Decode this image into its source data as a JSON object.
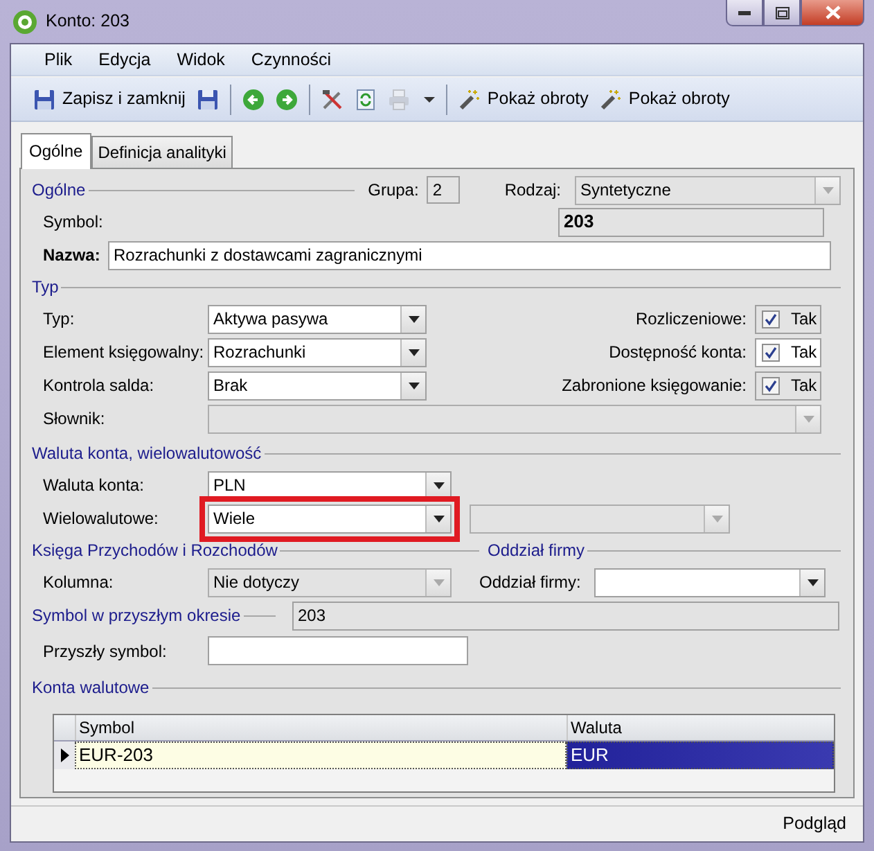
{
  "window": {
    "title": "Konto: 203"
  },
  "menu": [
    {
      "label": "Plik"
    },
    {
      "label": "Edycja"
    },
    {
      "label": "Widok"
    },
    {
      "label": "Czynności"
    }
  ],
  "toolbar": [
    {
      "kind": "button",
      "label": "Zapisz i zamknij",
      "disabled": false
    },
    {
      "kind": "icon",
      "disabled": false
    },
    {
      "kind": "separator"
    },
    {
      "kind": "icon",
      "disabled": false
    },
    {
      "kind": "icon",
      "disabled": false
    },
    {
      "kind": "separator"
    },
    {
      "kind": "icon",
      "disabled": false
    },
    {
      "kind": "icon",
      "disabled": false
    },
    {
      "kind": "dropdown",
      "disabled": true
    },
    {
      "kind": "separator"
    },
    {
      "kind": "button",
      "label": "Pokaż obroty",
      "disabled": false
    },
    {
      "kind": "button",
      "label": "Pokaż obroty",
      "disabled": false
    }
  ],
  "tabs": [
    {
      "label": "Ogólne",
      "selected": true
    },
    {
      "label": "Definicja analityki",
      "selected": false
    }
  ],
  "general": {
    "heading": "Ogólne",
    "group_label": "Grupa:",
    "group": "2",
    "kind_label": "Rodzaj:",
    "kind_value": "Syntetyczne",
    "symbol_label": "Symbol:",
    "symbol": "203",
    "name_label": "Nazwa:",
    "name": "Rozrachunki z dostawcami zagranicznymi"
  },
  "typ": {
    "heading": "Typ",
    "fields": [
      {
        "label": "Typ:",
        "value": "Aktywa pasywa",
        "disabled": false
      },
      {
        "label": "Element księgowalny:",
        "value": "Rozrachunki",
        "disabled": false
      },
      {
        "label": "Kontrola salda:",
        "value": "Brak",
        "disabled": false
      },
      {
        "label": "Słownik:",
        "disabled": true
      }
    ],
    "flags": [
      {
        "label": "Rozliczeniowe:",
        "text": "Tak",
        "checked": true,
        "disabled": true
      },
      {
        "label": "Dostępność konta:",
        "text": "Tak",
        "checked": true,
        "disabled": false
      },
      {
        "label": "Zabronione księgowanie:",
        "text": "Tak",
        "checked": true,
        "disabled": true
      }
    ]
  },
  "currency": {
    "heading": "Waluta konta, wielowalutowość",
    "fields": [
      {
        "label": "Waluta konta:",
        "value": "PLN",
        "highlighted": false
      },
      {
        "label": "Wielowalutowe:",
        "value": "Wiele",
        "highlighted": true,
        "secondary_disabled": true
      }
    ]
  },
  "ledger": {
    "heading": "Księga Przychodów i Rozchodów",
    "label": "Kolumna:",
    "value": "Nie dotyczy",
    "disabled": true
  },
  "branch": {
    "heading": "Oddział firmy",
    "label": "Oddział firmy:",
    "disabled": false
  },
  "future": {
    "heading": "Symbol w przyszłym okresie",
    "value": "203",
    "label": "Przyszły symbol:"
  },
  "currency_accounts": {
    "heading": "Konta walutowe",
    "columns": [
      "Symbol",
      "Waluta"
    ],
    "rows": [
      {
        "cells": [
          "EUR-203",
          "EUR"
        ],
        "selected": true
      }
    ]
  },
  "status_bar": {
    "text": "Podgląd"
  }
}
